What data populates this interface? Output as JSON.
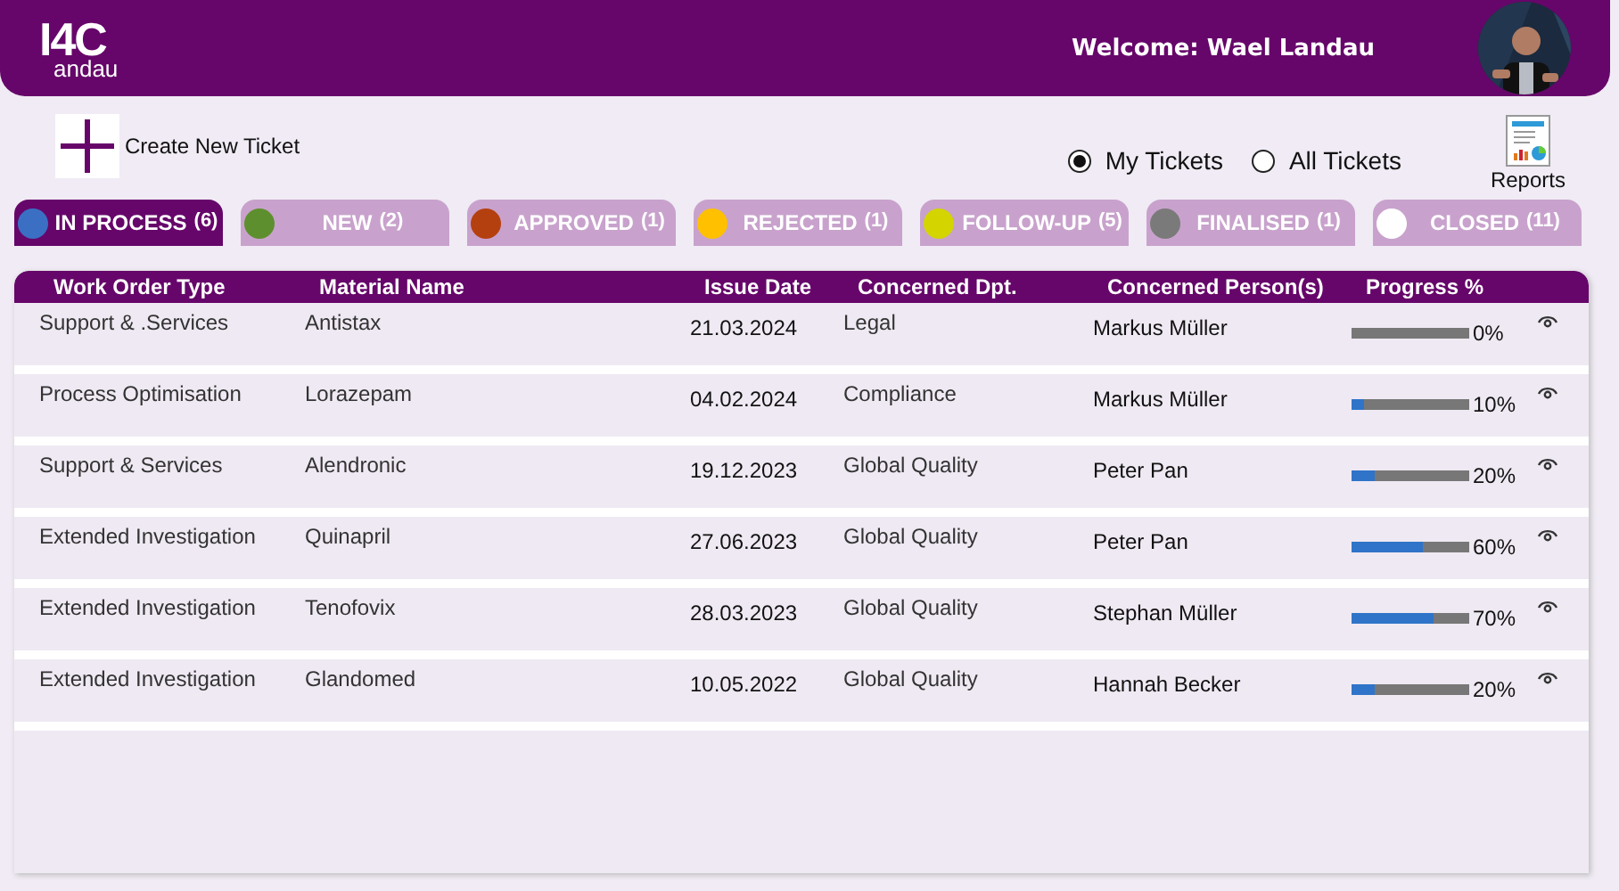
{
  "header": {
    "logo": {
      "top": "I4C",
      "bottom": "andau"
    },
    "welcome": "Welcome: Wael Landau"
  },
  "create_ticket": {
    "label": "Create New Ticket"
  },
  "filter": [
    {
      "label": "My Tickets",
      "selected": true
    },
    {
      "label": "All Tickets",
      "selected": false
    }
  ],
  "reports": {
    "label": "Reports"
  },
  "tabs": [
    {
      "label": "IN PROCESS",
      "count": "(6)",
      "color": "#3a6fc4",
      "selected": true
    },
    {
      "label": "NEW",
      "count": "(2)",
      "color": "#5e8f2e",
      "selected": false
    },
    {
      "label": "APPROVED",
      "count": "(1)",
      "color": "#b5400f",
      "selected": false
    },
    {
      "label": "REJECTED",
      "count": "(1)",
      "color": "#ffc000",
      "selected": false
    },
    {
      "label": "FOLLOW-UP",
      "count": "(5)",
      "color": "#d4d400",
      "selected": false
    },
    {
      "label": "FINALISED",
      "count": "(1)",
      "color": "#7a7a7a",
      "selected": false
    },
    {
      "label": "CLOSED",
      "count": "(11)",
      "color": "#ffffff",
      "selected": false
    }
  ],
  "table": {
    "columns": [
      "Work Order Type",
      "Material Name",
      "Issue Date",
      "Concerned Dpt.",
      "Concerned Person(s)",
      "Progress %"
    ],
    "rows": [
      {
        "type": "Support & .Services",
        "material": "Antistax",
        "date": "21.03.2024",
        "dept": "Legal",
        "person": "Markus Müller",
        "level": 0,
        "progress": "0%"
      },
      {
        "type": "Process Optimisation",
        "material": "Lorazepam",
        "date": "04.02.2024",
        "dept": "Compliance",
        "person": "Markus Müller",
        "level": 0.1,
        "progress": "10%"
      },
      {
        "type": "Support & Services",
        "material": "Alendronic",
        "date": "19.12.2023",
        "dept": "Global Quality",
        "person": "Peter Pan",
        "level": 0.2,
        "progress": "20%"
      },
      {
        "type": "Extended Investigation",
        "material": "Quinapril",
        "date": "27.06.2023",
        "dept": "Global Quality",
        "person": "Peter Pan",
        "level": 0.6,
        "progress": "60%"
      },
      {
        "type": "Extended Investigation",
        "material": "Tenofovix",
        "date": "28.03.2023",
        "dept": "Global Quality",
        "person": "Stephan Müller",
        "level": 0.7,
        "progress": "70%"
      },
      {
        "type": "Extended Investigation",
        "material": "Glandomed",
        "date": "10.05.2022",
        "dept": "Global Quality",
        "person": "Hannah Becker",
        "level": 0.2,
        "progress": "20%"
      }
    ]
  }
}
